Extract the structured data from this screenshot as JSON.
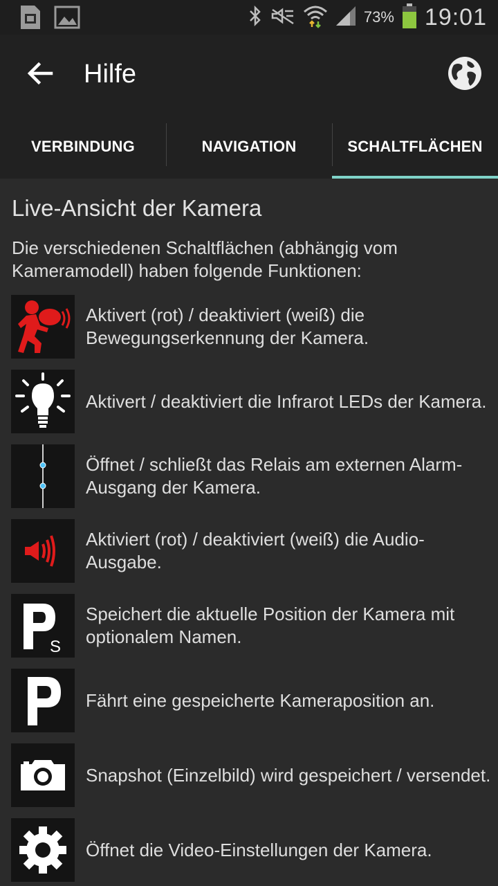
{
  "status_bar": {
    "battery_percent": "73%",
    "time": "19:01",
    "icons": [
      "sim-icon",
      "image-icon",
      "bluetooth-icon",
      "mute-icon",
      "wifi-icon",
      "signal-icon",
      "battery-icon"
    ]
  },
  "action_bar": {
    "title": "Hilfe"
  },
  "tabs": [
    {
      "label": "VERBINDUNG"
    },
    {
      "label": "NAVIGATION"
    },
    {
      "label": "SCHALTFLÄCHEN"
    }
  ],
  "active_tab": "SCHALTFLÄCHEN",
  "accent_color": "#7fd3c8",
  "section": {
    "heading": "Live-Ansicht der Kamera",
    "intro": "Die verschiedenen Schaltflächen (abhängig vom Kameramodell) haben folgende Funktionen:"
  },
  "items": [
    {
      "icon": "motion-detection-icon",
      "text": "Aktivert (rot) / deaktiviert (weiß) die Bewegungserkennung der Kamera."
    },
    {
      "icon": "infrared-bulb-icon",
      "text": "Aktivert / deaktiviert die Infrarot LEDs der Kamera."
    },
    {
      "icon": "relay-switch-icon",
      "text": "Öffnet / schließt das Relais am externen Alarm-Ausgang der Kamera."
    },
    {
      "icon": "speaker-icon",
      "text": "Aktiviert (rot) / deaktiviert (weiß) die Audio-Ausgabe."
    },
    {
      "icon": "save-position-icon",
      "text": "Speichert die aktuelle Position der Kamera mit optionalem Namen."
    },
    {
      "icon": "go-to-position-icon",
      "text": "Fährt eine gespeicherte Kameraposition an."
    },
    {
      "icon": "camera-icon",
      "text": "Snapshot (Einzelbild) wird gespeichert / versendet."
    },
    {
      "icon": "gear-icon",
      "text": "Öffnet die Video-Einstellungen der Kamera."
    }
  ]
}
